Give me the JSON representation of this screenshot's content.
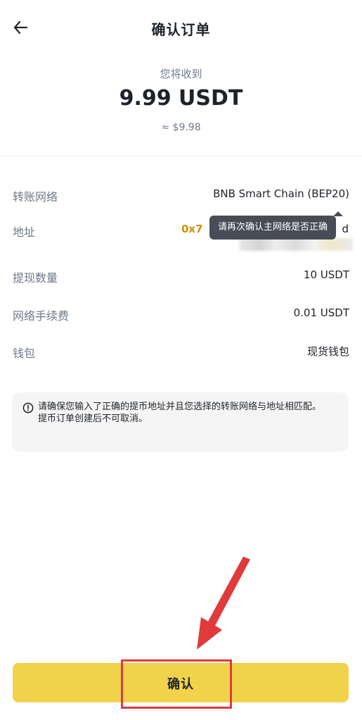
{
  "header": {
    "title": "确认订单",
    "back_icon": "arrow-left-icon"
  },
  "summary": {
    "receive_label": "您将收到",
    "amount": "9.99 USDT",
    "approx": "≈ $9.98"
  },
  "details": {
    "network_label": "转账网络",
    "network_value": "BNB Smart Chain (BEP20)",
    "address_label": "地址",
    "address_prefix": "0x7",
    "address_tail": "d",
    "tooltip": "请再次确认主网络是否正确",
    "amount_label": "提现数量",
    "amount_value": "10 USDT",
    "fee_label": "网络手续费",
    "fee_value": "0.01 USDT",
    "wallet_label": "钱包",
    "wallet_value": "现货钱包"
  },
  "notice": {
    "icon": "info-circle-icon",
    "line1": "请确保您输入了正确的提币地址并且您选择的转账网络与地址相匹配。",
    "line2": "提币订单创建后不可取消。"
  },
  "footer": {
    "confirm_label": "确认"
  },
  "colors": {
    "accent_yellow": "#f0d34b",
    "address_highlight": "#c99400",
    "annotation_red": "#e03a3a",
    "tooltip_bg": "#474d57"
  }
}
